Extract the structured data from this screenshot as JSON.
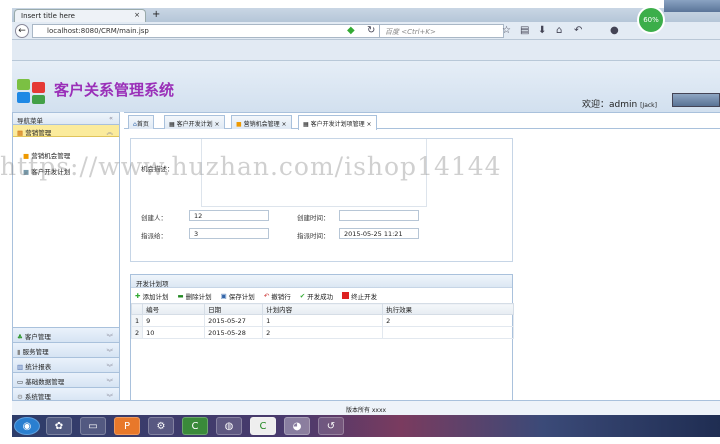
{
  "browser": {
    "tab_title": "Insert title here",
    "new_tab": "+",
    "url": "localhost:8080/CRM/main.jsp",
    "search_placeholder": "百度 <Ctrl+K>",
    "net_percent": "60%"
  },
  "header": {
    "app_title": "客户关系管理系统",
    "welcome": "欢迎：admin",
    "role": "[Jack]"
  },
  "sidebar": {
    "title": "导航菜单",
    "open_section": "营销管理",
    "items": [
      "营销机会管理",
      "客户开发计划"
    ],
    "sections": [
      "客户管理",
      "服务管理",
      "统计报表",
      "基础数据管理",
      "系统管理"
    ]
  },
  "tabs": [
    "首页",
    "客户开发计划",
    "营销机会管理",
    "客户开发计划项管理"
  ],
  "form": {
    "desc_label": "机会描述：",
    "creator_label": "创建人：",
    "creator": "12",
    "created_time_label": "创建时间：",
    "created_time": "",
    "assignee_label": "指派给：",
    "assignee": "3",
    "assign_time_label": "指派时间：",
    "assign_time": "2015-05-25 11:21"
  },
  "plan": {
    "title": "开发计划项",
    "toolbar": [
      "添加计划",
      "删除计划",
      "保存计划",
      "撤销行",
      "开发成功",
      "终止开发"
    ],
    "columns": [
      "编号",
      "日期",
      "计划内容",
      "执行效果"
    ],
    "rows": [
      {
        "n": "1",
        "id": "9",
        "date": "2015-05-27",
        "content": "1",
        "result": "2"
      },
      {
        "n": "2",
        "id": "10",
        "date": "2015-05-28",
        "content": "2",
        "result": ""
      }
    ]
  },
  "footer": "版本所有 xxxx",
  "watermark": "https://www.huzhan.com/ishop14144"
}
